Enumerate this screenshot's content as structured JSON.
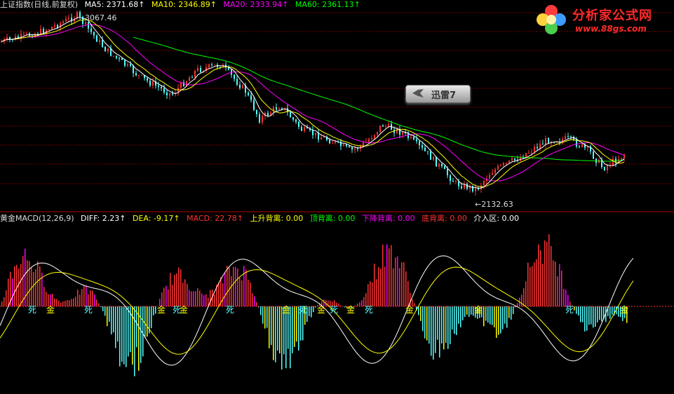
{
  "top": {
    "index_name": "上证指数(日线,前复权)",
    "ma5": "MA5: 2371.68↑",
    "ma10": "MA10: 2346.89↑",
    "ma20": "MA20: 2333.94↑",
    "ma60": "MA60: 2361.13↑",
    "high_label": "3067.46",
    "low_label": "←2132.63"
  },
  "bottom": {
    "indicator": "黄金MACD(12,26,9)",
    "diff": "DIFF: 2.23↑",
    "dea": "DEA: -9.17↑",
    "macd": "MACD: 22.78↑",
    "rise_div": "上升背离: 0.00",
    "top_div": "顶背离: 0.00",
    "fall_div": "下降背离: 0.00",
    "bottom_div": "底背离: 0.00",
    "entry": "介入区: 0.00",
    "signals": [
      "死",
      "金",
      "死",
      "金",
      "死",
      "金",
      "死",
      "金",
      "死",
      "金",
      "死",
      "金",
      "死",
      "金",
      "金",
      "死",
      "金"
    ]
  },
  "logo": {
    "name": "分析家公式网",
    "url": "www.88gs.com"
  },
  "overlay": {
    "button_label": "迅雷7"
  },
  "colors": {
    "background": "#000000",
    "grid": "#7a0000",
    "up_candle": "#ff3232",
    "down_candle": "#54ffff",
    "ma5": "#ffffff",
    "ma10": "#ffff00",
    "ma20": "#ff00ff",
    "ma60": "#00ff00",
    "macd_pos": "#ff3232",
    "macd_neg": "#54ffff"
  }
}
